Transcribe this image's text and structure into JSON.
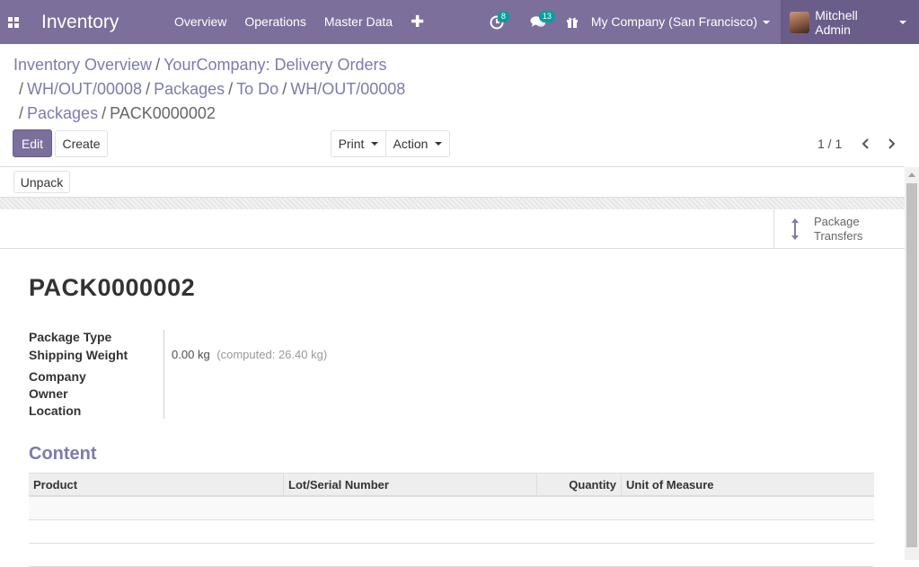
{
  "navbar": {
    "brand": "Inventory",
    "menu": [
      "Overview",
      "Operations",
      "Master Data"
    ],
    "plus_icon": "plus-icon",
    "activity_badge": "8",
    "messages_badge": "13",
    "company": "My Company (San Francisco)",
    "user": "Mitchell Admin",
    "accent_color": "#7c6f9b"
  },
  "breadcrumb": {
    "items": [
      "Inventory Overview",
      "YourCompany: Delivery Orders",
      "WH/OUT/00008",
      "Packages",
      "To Do",
      "WH/OUT/00008",
      "Packages"
    ],
    "current": "PACK0000002"
  },
  "controls": {
    "edit": "Edit",
    "create": "Create",
    "print": "Print",
    "action": "Action",
    "pager": "1 / 1"
  },
  "header": {
    "unpack": "Unpack"
  },
  "smart_button": {
    "line1": "Package",
    "line2": "Transfers",
    "icon": "arrows-v-icon"
  },
  "record": {
    "title": "PACK0000002",
    "labels": {
      "package_type": "Package Type",
      "shipping_weight": "Shipping Weight",
      "company": "Company",
      "owner": "Owner",
      "location": "Location"
    },
    "shipping_weight_value": "0.00",
    "shipping_weight_unit": "kg",
    "computed_weight": "(computed: 26.40 kg)"
  },
  "content": {
    "title": "Content",
    "columns": [
      "Product",
      "Lot/Serial Number",
      "Quantity",
      "Unit of Measure"
    ],
    "rows": []
  }
}
